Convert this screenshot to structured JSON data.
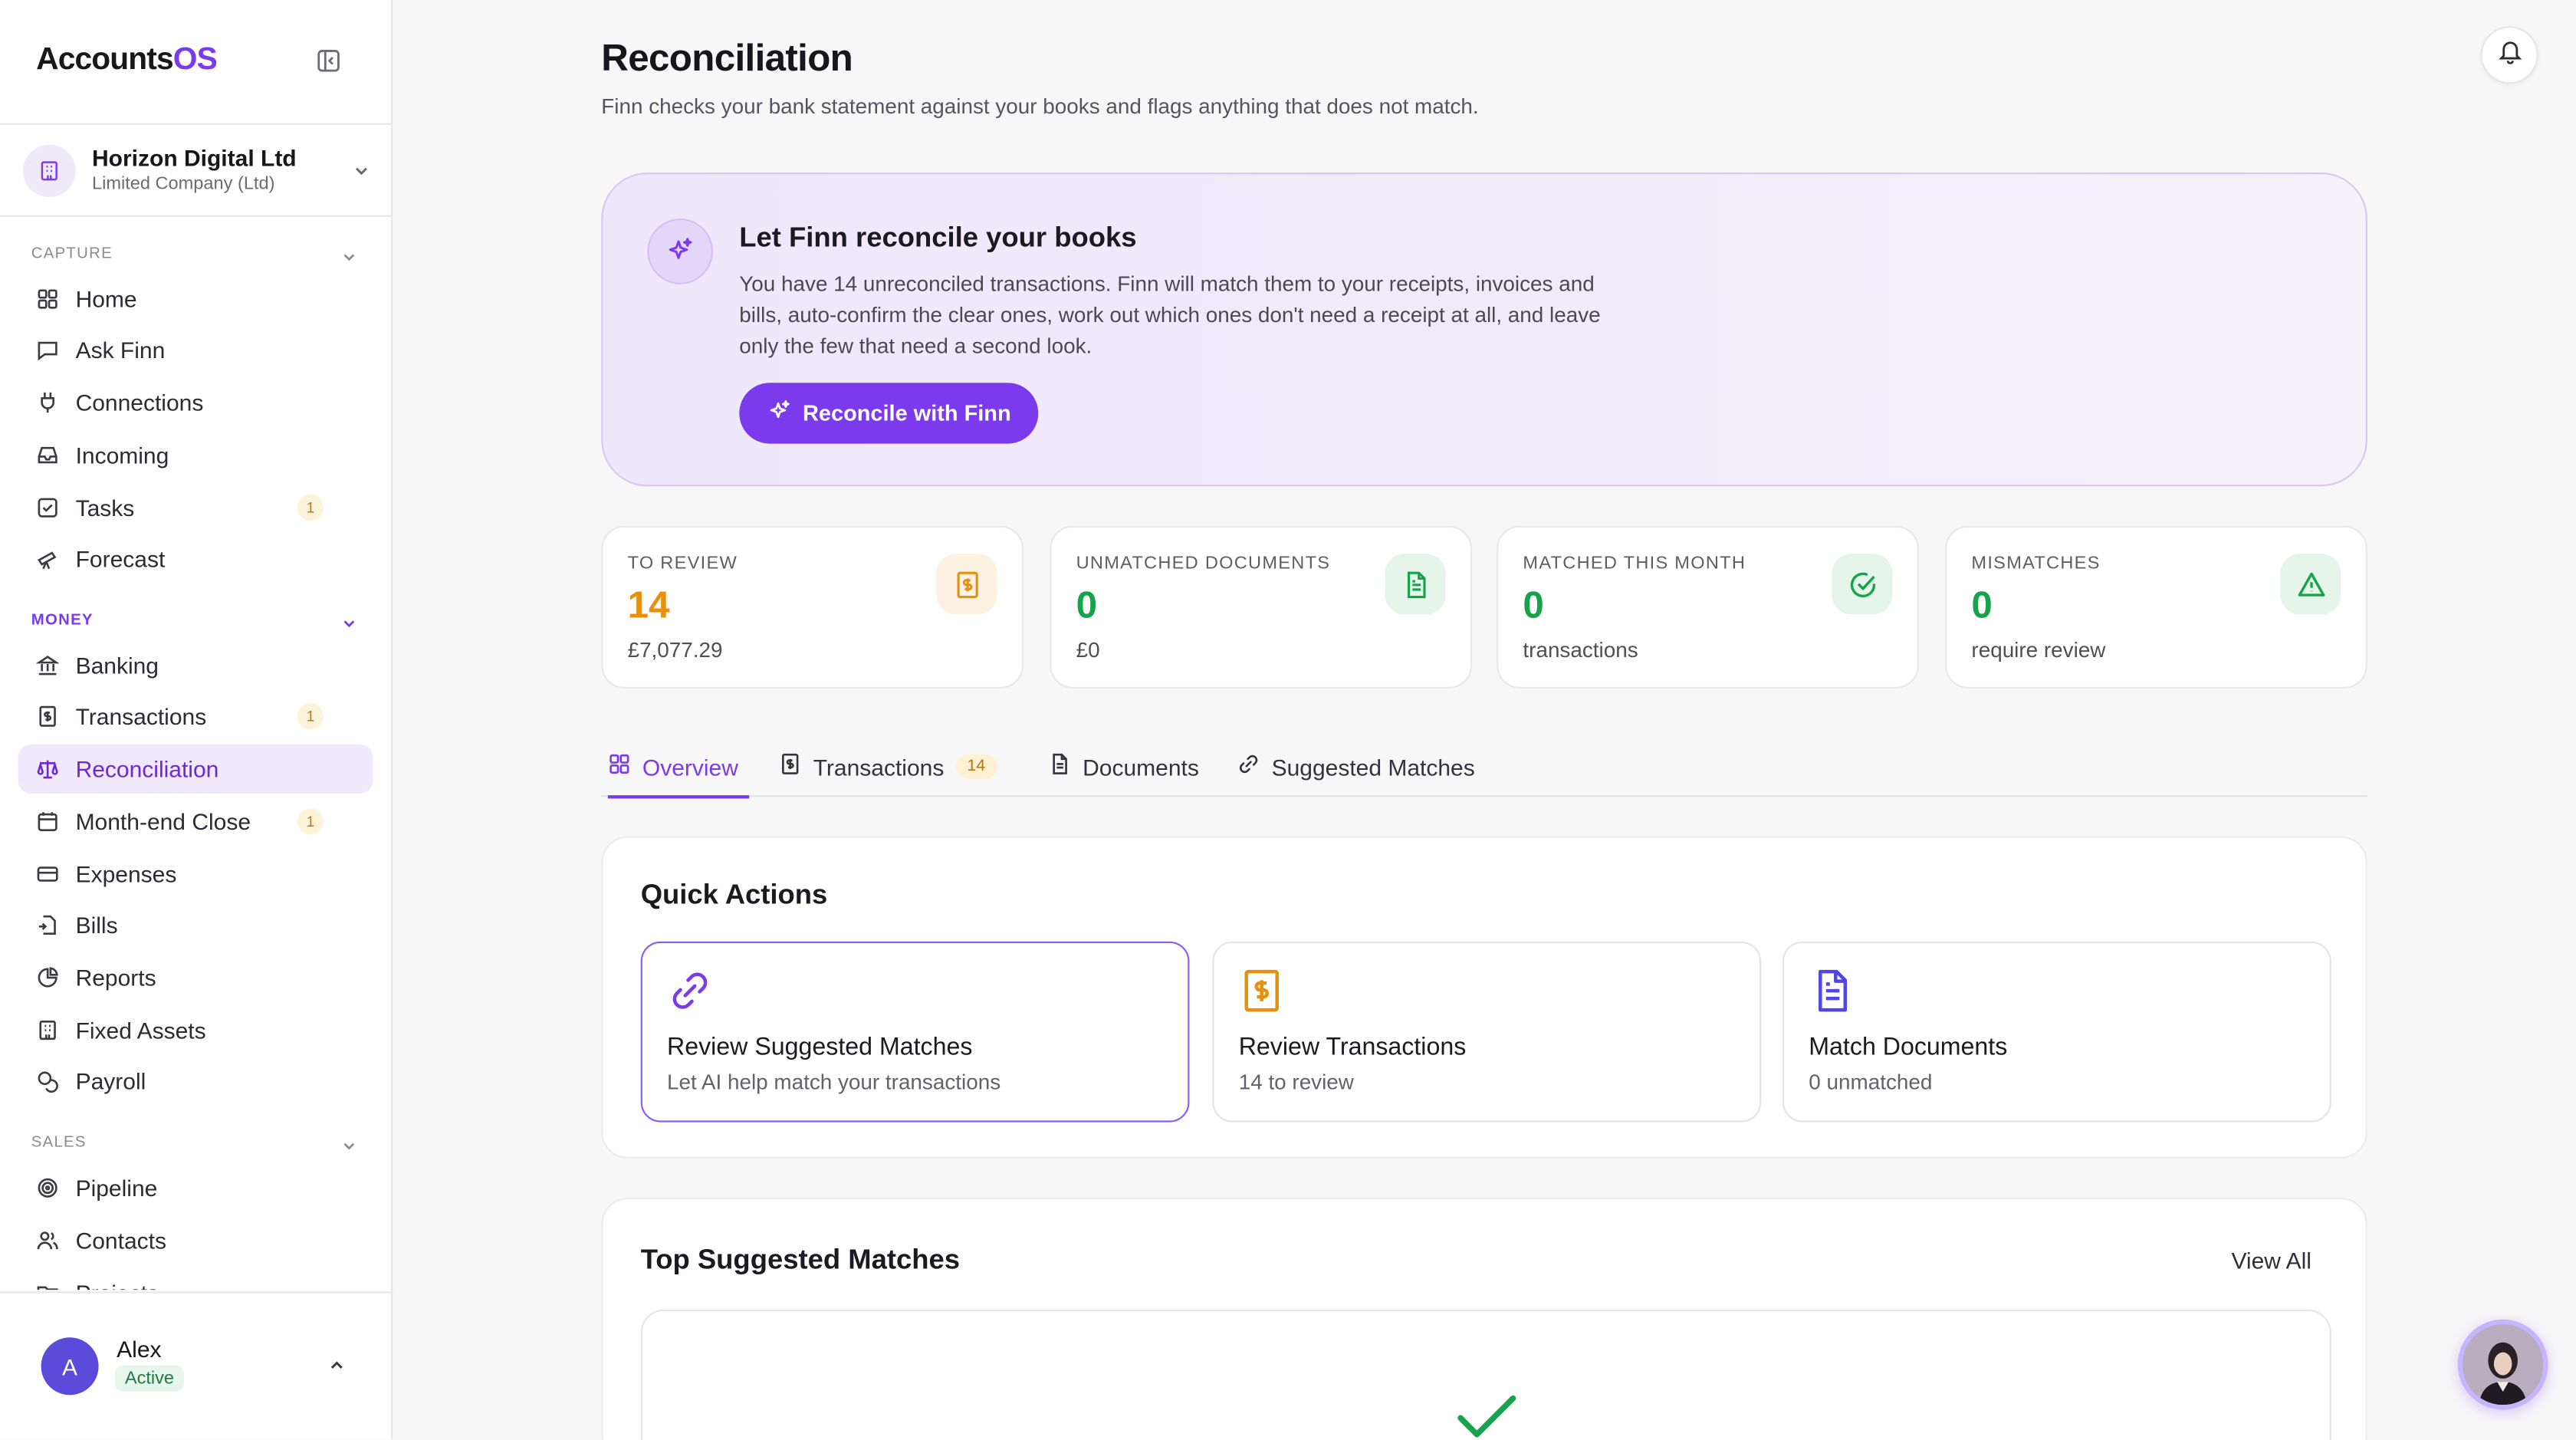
{
  "app": {
    "brand_main": "Accounts",
    "brand_accent": "OS",
    "accent_color": "#7c3aed"
  },
  "org": {
    "name": "Horizon Digital Ltd",
    "type": "Limited Company (Ltd)"
  },
  "sidebar": {
    "sections": [
      {
        "label": "CAPTURE",
        "items": [
          {
            "label": "Home",
            "icon": "grid-icon"
          },
          {
            "label": "Ask Finn",
            "icon": "chat-icon"
          },
          {
            "label": "Connections",
            "icon": "plug-icon"
          },
          {
            "label": "Incoming",
            "icon": "inbox-icon"
          },
          {
            "label": "Tasks",
            "icon": "checkbox-icon",
            "badge": "1"
          },
          {
            "label": "Forecast",
            "icon": "telescope-icon"
          }
        ]
      },
      {
        "label": "MONEY",
        "items": [
          {
            "label": "Banking",
            "icon": "bank-icon"
          },
          {
            "label": "Transactions",
            "icon": "receipt-icon",
            "badge": "1"
          },
          {
            "label": "Reconciliation",
            "icon": "scale-icon",
            "active": true
          },
          {
            "label": "Month-end Close",
            "icon": "calendar-icon",
            "badge": "1"
          },
          {
            "label": "Expenses",
            "icon": "card-icon"
          },
          {
            "label": "Bills",
            "icon": "file-in-icon"
          },
          {
            "label": "Reports",
            "icon": "pie-icon"
          },
          {
            "label": "Fixed Assets",
            "icon": "building-icon"
          },
          {
            "label": "Payroll",
            "icon": "coins-icon"
          }
        ]
      },
      {
        "label": "SALES",
        "items": [
          {
            "label": "Pipeline",
            "icon": "target-icon"
          },
          {
            "label": "Contacts",
            "icon": "users-icon"
          },
          {
            "label": "Projects",
            "icon": "folder-icon"
          }
        ]
      }
    ]
  },
  "user": {
    "initial": "A",
    "name": "Alex",
    "status": "Active"
  },
  "page": {
    "title": "Reconciliation",
    "subtitle": "Finn checks your bank statement against your books and flags anything that does not match."
  },
  "hero": {
    "title": "Let Finn reconcile your books",
    "body": "You have 14 unreconciled transactions. Finn will match them to your receipts, invoices and bills, auto-confirm the clear ones, work out which ones don't need a receipt at all, and leave only the few that need a second look.",
    "button": "Reconcile with Finn"
  },
  "stats": [
    {
      "label": "TO REVIEW",
      "value": "14",
      "sub": "£7,077.29",
      "color": "#e8900c",
      "icon": "receipt-icon"
    },
    {
      "label": "UNMATCHED DOCUMENTS",
      "value": "0",
      "sub": "£0",
      "color": "#16a34a",
      "icon": "document-icon"
    },
    {
      "label": "MATCHED THIS MONTH",
      "value": "0",
      "sub": "transactions",
      "color": "#16a34a",
      "icon": "check-circle-icon"
    },
    {
      "label": "MISMATCHES",
      "value": "0",
      "sub": "require review",
      "color": "#16a34a",
      "icon": "warning-icon"
    }
  ],
  "tabs": [
    {
      "label": "Overview",
      "active": true
    },
    {
      "label": "Transactions",
      "count": "14"
    },
    {
      "label": "Documents"
    },
    {
      "label": "Suggested Matches"
    }
  ],
  "quick_actions": {
    "title": "Quick Actions",
    "cards": [
      {
        "title": "Review Suggested Matches",
        "sub": "Let AI help match your transactions",
        "icon": "link-icon"
      },
      {
        "title": "Review Transactions",
        "sub": "14 to review",
        "icon": "receipt-icon"
      },
      {
        "title": "Match Documents",
        "sub": "0 unmatched",
        "icon": "document-icon"
      }
    ]
  },
  "top_matches": {
    "title": "Top Suggested Matches",
    "view_all": "View All"
  }
}
